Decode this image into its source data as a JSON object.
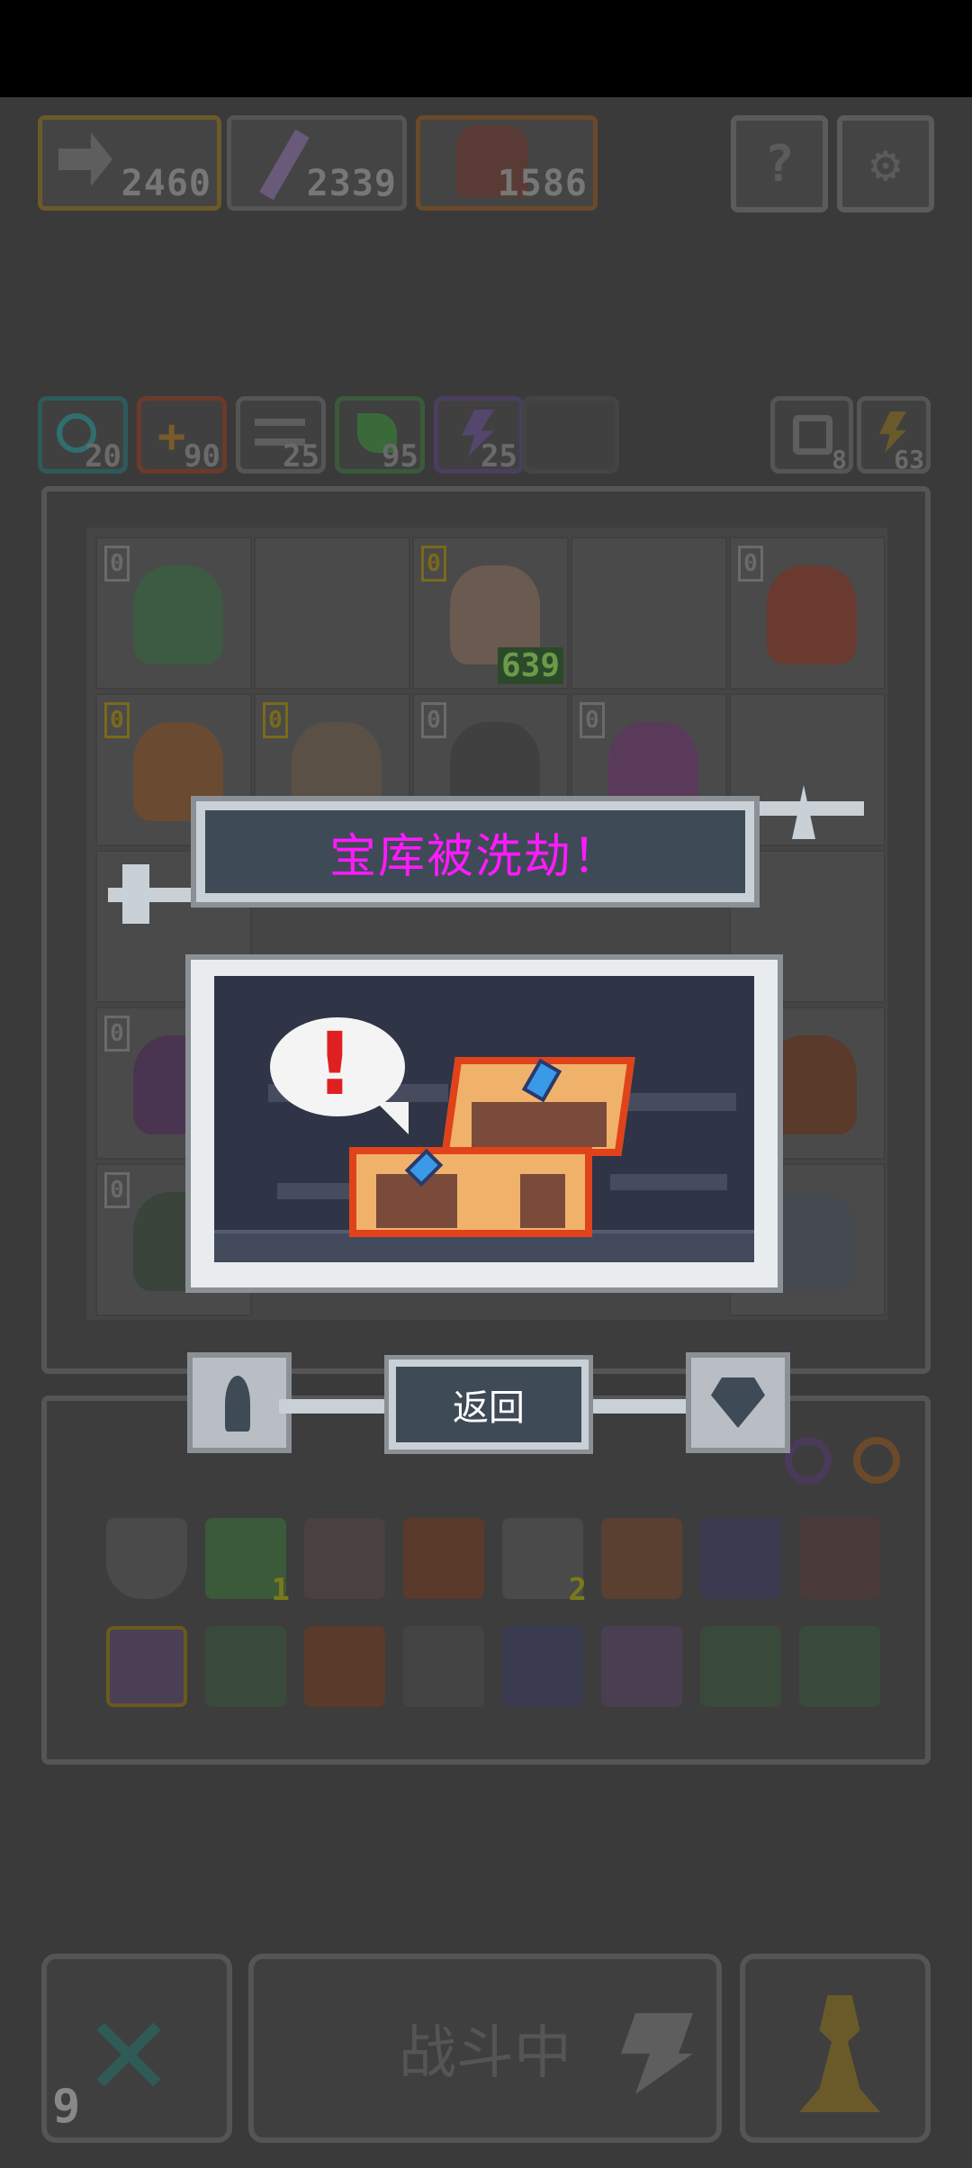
{
  "stats": {
    "left_value": "2460",
    "mid_value": "2339",
    "right_value": "1586"
  },
  "top_buttons": {
    "help_label": "?",
    "settings_label": "⚙"
  },
  "resources": [
    {
      "icon": "shield-bubble-icon",
      "value": "20",
      "color": "#2f6f6f"
    },
    {
      "icon": "plus-icon",
      "value": "90",
      "color": "#7a4a2a"
    },
    {
      "icon": "wing-icon",
      "value": "25",
      "color": "#5a5a5a"
    },
    {
      "icon": "leaf-icon",
      "value": "95",
      "color": "#3a6a3a"
    },
    {
      "icon": "lightning-icon",
      "value": "25",
      "color": "#55466e"
    }
  ],
  "side_counters": {
    "refresh_value": "8",
    "bolt_value": "63"
  },
  "board": {
    "cells": [
      {
        "lv": "0",
        "color": "#3d5a42"
      },
      {
        "lv": "",
        "color": ""
      },
      {
        "lv": "0",
        "color": "#6a5a50",
        "hp": "639"
      },
      {
        "lv": "",
        "color": ""
      },
      {
        "lv": "0",
        "color": "#6a3a30"
      },
      {
        "lv": "0",
        "color": "#6a4a30"
      },
      {
        "lv": "0",
        "color": "#5a5045"
      },
      {
        "lv": "0",
        "color": "#404040"
      },
      {
        "lv": "0",
        "color": "#5a3a5a"
      },
      {
        "lv": "",
        "color": ""
      }
    ]
  },
  "modal": {
    "title": "宝库被洗劫！",
    "exclamation": "!",
    "return_label": "返回"
  },
  "inventory": {
    "row1_badges": [
      "1",
      "2"
    ]
  },
  "bottom": {
    "battle_label": "战斗中",
    "close_count": "9"
  },
  "colors": {
    "title_magenta": "#ff1aff",
    "frame_light": "#c9d0d6",
    "panel_dark": "#3e4a55"
  }
}
